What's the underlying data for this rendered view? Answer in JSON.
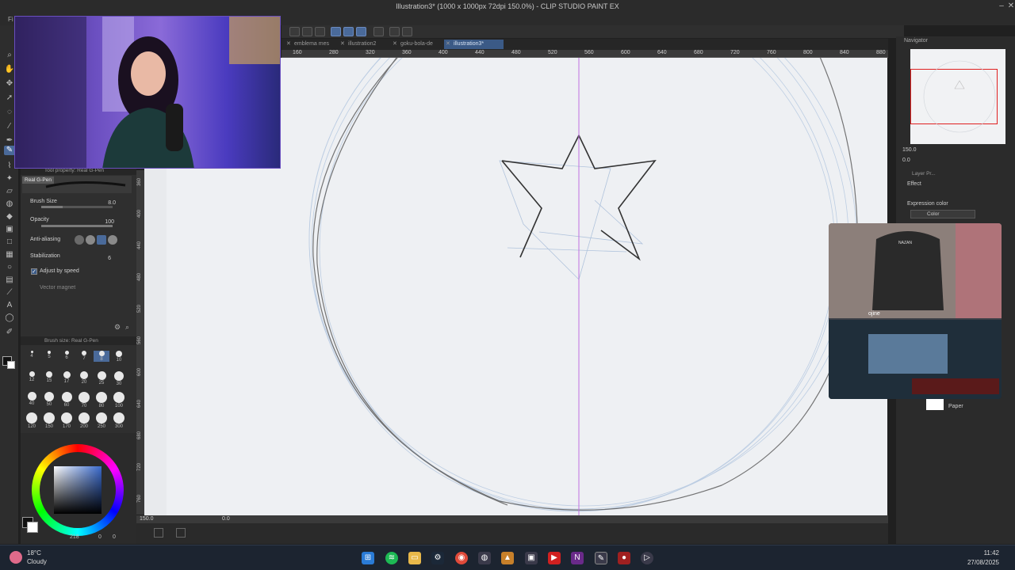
{
  "window": {
    "title": "Illustration3* (1000 x 1000px 72dpi 150.0%) - CLIP STUDIO PAINT EX",
    "menu_fragment": "Fi"
  },
  "tabs": [
    {
      "label": "emblema mes",
      "active": false
    },
    {
      "label": "illustration2",
      "active": false
    },
    {
      "label": "goku-bola-de",
      "active": false
    },
    {
      "label": "illustration3*",
      "active": true
    }
  ],
  "ruler_top": [
    "160",
    "280",
    "320",
    "360",
    "400",
    "440",
    "480",
    "520",
    "560",
    "600",
    "640",
    "680",
    "720",
    "760",
    "800",
    "840",
    "880"
  ],
  "ruler_left": [
    "360",
    "400",
    "440",
    "480",
    "520",
    "560",
    "600",
    "640",
    "680",
    "720",
    "760"
  ],
  "tool_property": {
    "header": "Tool property: Real G-Pen",
    "brush_name": "Real G-Pen",
    "brush_size_label": "Brush Size",
    "brush_size_value": "8.0",
    "brush_size_level": 0.3,
    "opacity_label": "Opacity",
    "opacity_value": "100",
    "opacity_level": 1.0,
    "antialiasing_label": "Anti-aliasing",
    "stabilization_label": "Stabilization",
    "stabilization_value": "6",
    "adjust_speed_label": "Adjust by speed",
    "vector_magnet_label": "Vector magnet"
  },
  "brush_size_palette": {
    "header": "Brush size: Real G-Pen",
    "sizes": [
      "4",
      "5",
      "6",
      "7",
      "8",
      "10",
      "12",
      "15",
      "17",
      "20",
      "25",
      "30",
      "40",
      "50",
      "60",
      "70",
      "80",
      "100",
      "120",
      "150",
      "170",
      "200",
      "250",
      "300"
    ],
    "selected": "8"
  },
  "color": {
    "main": "#111111",
    "sub": "#ffffff",
    "readout": "218",
    "readout2": "0",
    "readout3": "0"
  },
  "canvas_bottom": {
    "zoom": "150.0",
    "angle": "0.0"
  },
  "navigator": {
    "title": "Navigator",
    "zoom": "150.0",
    "angle": "0.0"
  },
  "layer_panel": {
    "tab": "Layer Pr...",
    "effect_label": "Effect",
    "expression_label": "Expression color",
    "expression_value": "Color",
    "paper_label": "Paper"
  },
  "webcam2": {
    "headrest_text": "NAZAN",
    "mic_label": "ojine"
  },
  "taskbar": {
    "temperature": "18°C",
    "weather": "Cloudy",
    "time": "11:42",
    "date": "27/08/2025"
  },
  "colors": {
    "accent": "#3b5a86",
    "canvas": "#eef0f3",
    "guide": "#c070e0",
    "nav_frame": "#e02020"
  }
}
